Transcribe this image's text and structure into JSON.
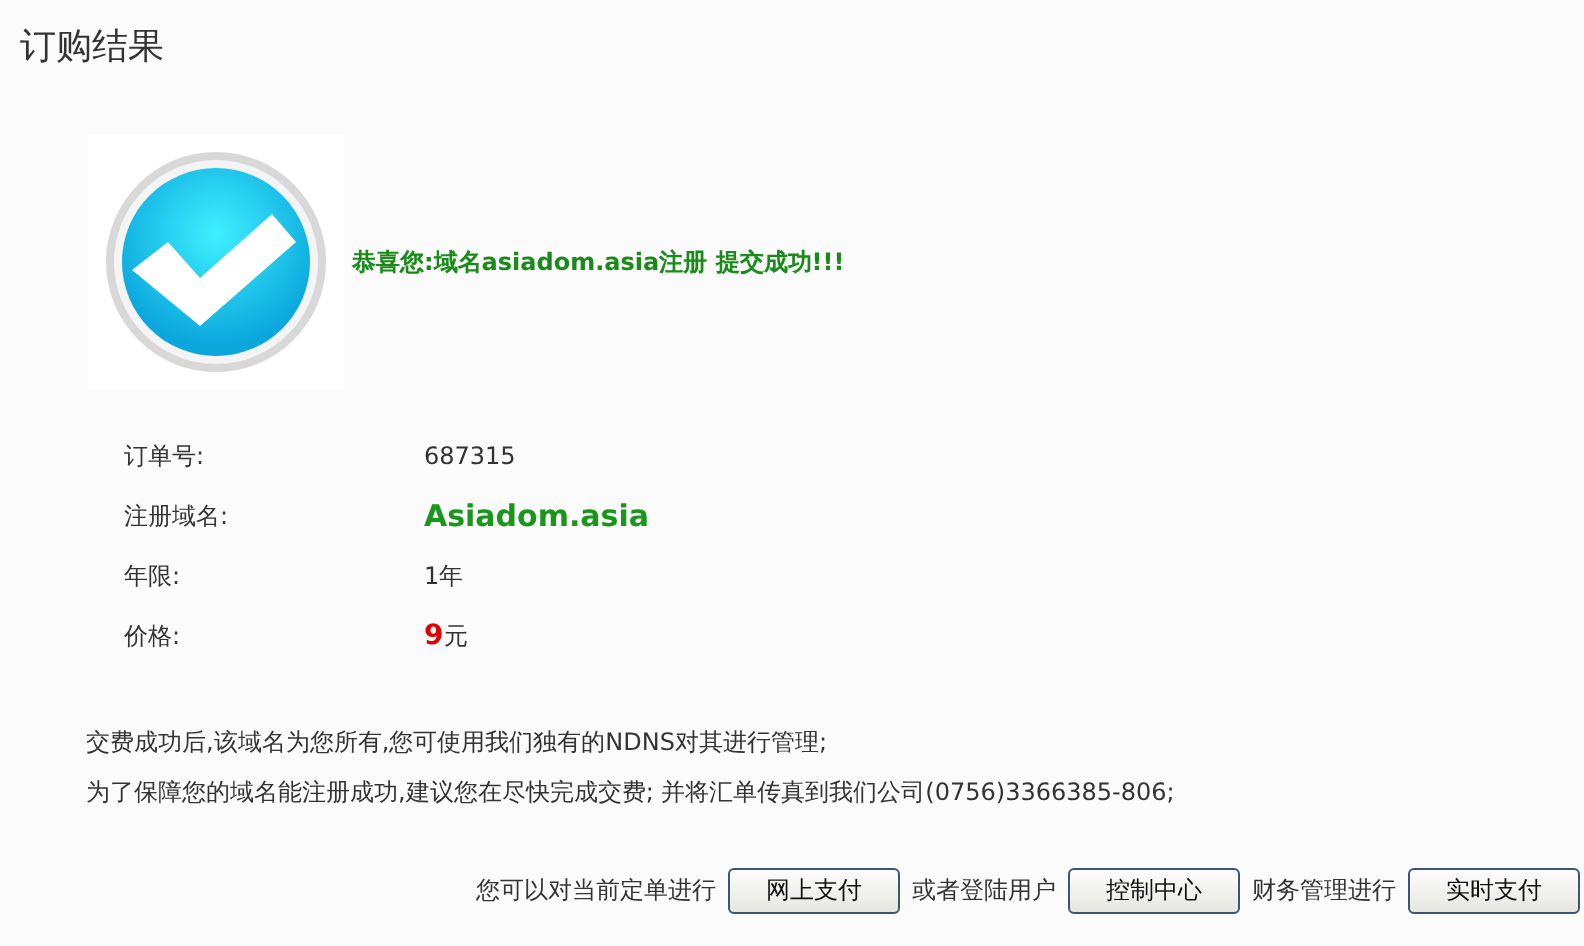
{
  "title": "订购结果",
  "success_message": "恭喜您:域名asiadom.asia注册 提交成功!!!",
  "details": [
    {
      "kind": "plain",
      "label": "订单号:",
      "value": "687315"
    },
    {
      "kind": "domain",
      "label": "注册域名:",
      "value": "Asiadom.asia"
    },
    {
      "kind": "plain",
      "label": "年限:",
      "value": "1年"
    },
    {
      "kind": "price",
      "label": "价格:",
      "value": "**9**元"
    }
  ],
  "notes": [
    "交费成功后,该域名为您所有,您可使用我们独有的NDNS对其进行管理;",
    "为了保障您的域名能注册成功,建议您在尽快完成交费; 并将汇单传真到我们公司(0756)3366385-806;"
  ],
  "actions": [
    {
      "text": "您可以对当前定单进行",
      "button": "网上支付"
    },
    {
      "text": "或者登陆用户",
      "button": "控制中心"
    },
    {
      "text": "财务管理进行",
      "button": "实时支付"
    }
  ]
}
